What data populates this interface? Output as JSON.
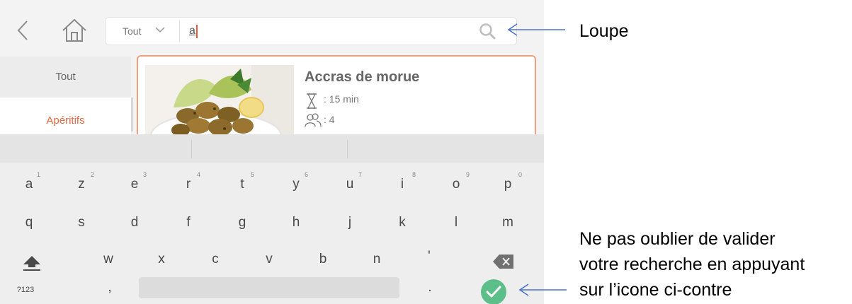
{
  "topbar": {
    "filter_label": "Tout",
    "search_query": "a"
  },
  "sidebar": {
    "items": [
      {
        "label": "Tout"
      },
      {
        "label": "Apéritifs"
      }
    ]
  },
  "recipe": {
    "title": "Accras de morue",
    "time": ": 15 min",
    "servings": ": 4"
  },
  "keyboard": {
    "row1": [
      {
        "key": "a",
        "hint": "1"
      },
      {
        "key": "z",
        "hint": "2"
      },
      {
        "key": "e",
        "hint": "3"
      },
      {
        "key": "r",
        "hint": "4"
      },
      {
        "key": "t",
        "hint": "5"
      },
      {
        "key": "y",
        "hint": "6"
      },
      {
        "key": "u",
        "hint": "7"
      },
      {
        "key": "i",
        "hint": "8"
      },
      {
        "key": "o",
        "hint": "9"
      },
      {
        "key": "p",
        "hint": "0"
      }
    ],
    "row2": [
      "q",
      "s",
      "d",
      "f",
      "g",
      "h",
      "j",
      "k",
      "l",
      "m"
    ],
    "row3": [
      "w",
      "x",
      "c",
      "v",
      "b",
      "n",
      "'"
    ],
    "symbols_key": "?123",
    "comma_key": ",",
    "period_key": "."
  },
  "annotations": {
    "loupe": "Loupe",
    "validate": [
      "Ne pas oublier de valider",
      "votre recherche en appuyant",
      "sur l’icone ci-contre"
    ]
  },
  "colors": {
    "accent": "#e8673f",
    "validate_green": "#5cbf8a"
  }
}
